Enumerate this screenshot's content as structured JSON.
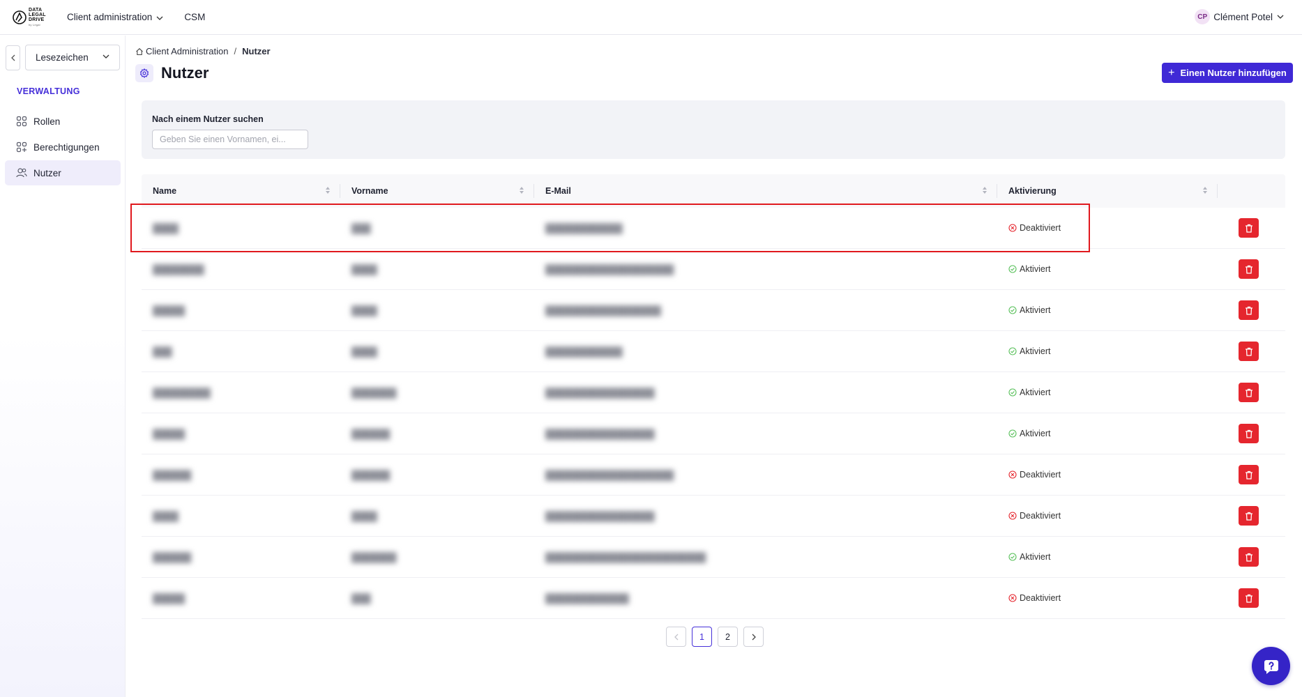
{
  "brand": {
    "logo_lines": [
      "DATA",
      "LEGAL",
      "DRIVE"
    ],
    "logo_tagline": "by Legal"
  },
  "topnav": {
    "client_admin": "Client administration",
    "csm": "CSM"
  },
  "user": {
    "initials": "CP",
    "name": "Clément Potel"
  },
  "sidebar": {
    "bookmarks_label": "Lesezeichen",
    "section_title": "VERWALTUNG",
    "items": [
      {
        "label": "Rollen",
        "icon": "grid-icon"
      },
      {
        "label": "Berechtigungen",
        "icon": "grid-plus-icon"
      },
      {
        "label": "Nutzer",
        "icon": "users-icon",
        "active": true
      }
    ]
  },
  "breadcrumb": {
    "root": "Client Administration",
    "separator": "/",
    "current": "Nutzer"
  },
  "page": {
    "title": "Nutzer",
    "add_button": "Einen Nutzer hinzufügen"
  },
  "search": {
    "label": "Nach einem Nutzer suchen",
    "placeholder": "Geben Sie einen Vornamen, ei..."
  },
  "table": {
    "columns": [
      "Name",
      "Vorname",
      "E-Mail",
      "Aktivierung"
    ],
    "rows": [
      {
        "name": "████",
        "first": "███",
        "email": "████████████",
        "status": "Deaktiviert",
        "active": false
      },
      {
        "name": "████████",
        "first": "████",
        "email": "████████████████████",
        "status": "Aktiviert",
        "active": true
      },
      {
        "name": "█████",
        "first": "████",
        "email": "██████████████████",
        "status": "Aktiviert",
        "active": true
      },
      {
        "name": "███",
        "first": "████",
        "email": "████████████",
        "status": "Aktiviert",
        "active": true
      },
      {
        "name": "█████████",
        "first": "███████",
        "email": "█████████████████",
        "status": "Aktiviert",
        "active": true
      },
      {
        "name": "█████",
        "first": "██████",
        "email": "█████████████████",
        "status": "Aktiviert",
        "active": true
      },
      {
        "name": "██████",
        "first": "██████",
        "email": "████████████████████",
        "status": "Deaktiviert",
        "active": false
      },
      {
        "name": "████",
        "first": "████",
        "email": "█████████████████",
        "status": "Deaktiviert",
        "active": false
      },
      {
        "name": "██████",
        "first": "███████",
        "email": "█████████████████████████",
        "status": "Aktiviert",
        "active": true
      },
      {
        "name": "█████",
        "first": "███",
        "email": "█████████████",
        "status": "Deaktiviert",
        "active": false
      }
    ]
  },
  "pagination": {
    "prev": "<",
    "pages": [
      "1",
      "2"
    ],
    "current": "1",
    "next": ">"
  },
  "colors": {
    "accent": "#3f29d6",
    "danger": "#e5262e",
    "success": "#58c05a",
    "highlight": "#e0191e"
  }
}
